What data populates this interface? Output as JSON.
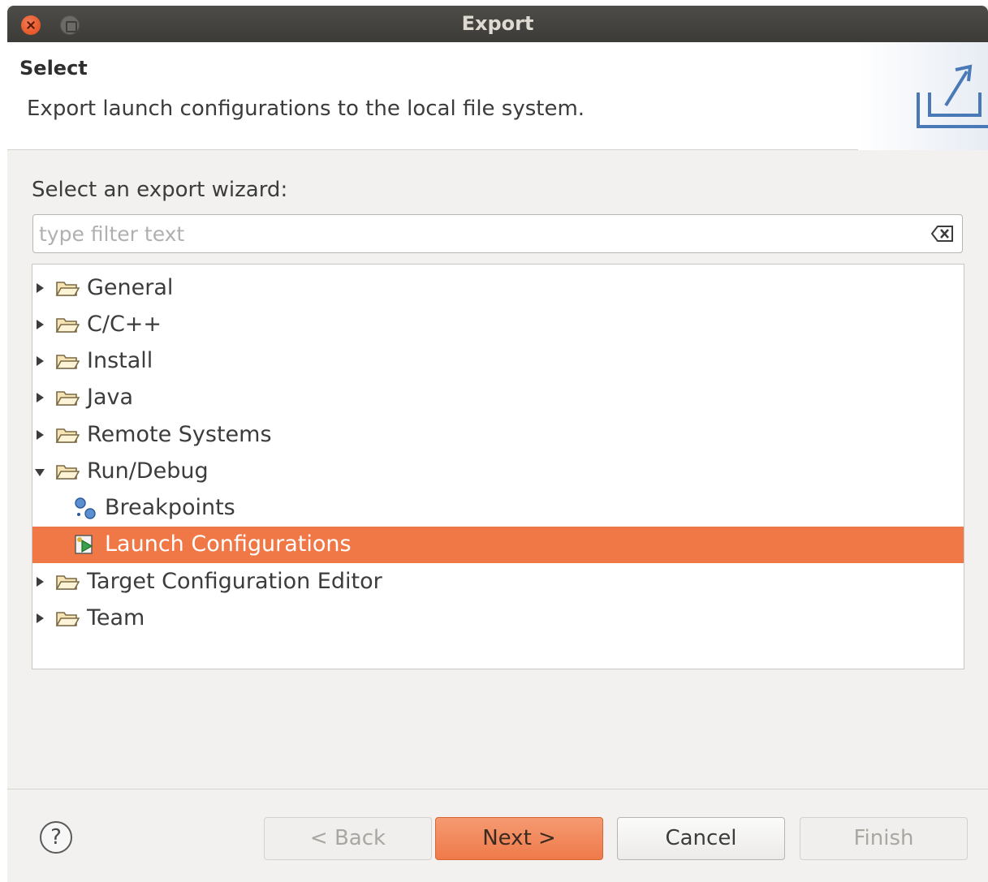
{
  "window": {
    "title": "Export"
  },
  "header": {
    "title": "Select",
    "description": "Export launch configurations to the local file system."
  },
  "wizard": {
    "label": "Select an export wizard:",
    "filter_placeholder": "type filter text",
    "filter_value": ""
  },
  "tree": {
    "items": [
      {
        "label": "General",
        "expanded": false,
        "level": 0,
        "icon": "folder-icon"
      },
      {
        "label": "C/C++",
        "expanded": false,
        "level": 0,
        "icon": "folder-icon"
      },
      {
        "label": "Install",
        "expanded": false,
        "level": 0,
        "icon": "folder-icon"
      },
      {
        "label": "Java",
        "expanded": false,
        "level": 0,
        "icon": "folder-icon"
      },
      {
        "label": "Remote Systems",
        "expanded": false,
        "level": 0,
        "icon": "folder-icon"
      },
      {
        "label": "Run/Debug",
        "expanded": true,
        "level": 0,
        "icon": "folder-icon"
      },
      {
        "label": "Breakpoints",
        "level": 1,
        "icon": "breakpoints-icon"
      },
      {
        "label": "Launch Configurations",
        "level": 1,
        "icon": "launch-config-icon",
        "selected": true
      },
      {
        "label": "Target Configuration Editor",
        "expanded": false,
        "level": 0,
        "icon": "folder-icon"
      },
      {
        "label": "Team",
        "expanded": false,
        "level": 0,
        "icon": "folder-icon"
      }
    ]
  },
  "buttons": {
    "back": "< Back",
    "next": "Next >",
    "cancel": "Cancel",
    "finish": "Finish",
    "help": "?"
  },
  "colors": {
    "selection": "#f07746",
    "titlebar": "#3c3b37"
  }
}
